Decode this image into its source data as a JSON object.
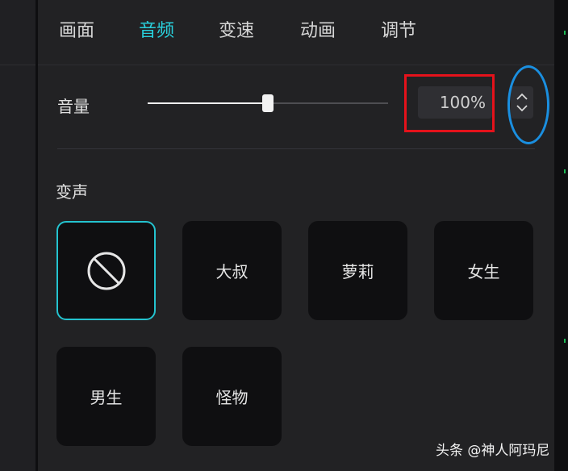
{
  "tabs": [
    "画面",
    "音频",
    "变速",
    "动画",
    "调节"
  ],
  "active_tab": "音频",
  "volume": {
    "label": "音量",
    "value_text": "100%",
    "level_fraction": 0.5
  },
  "voice_change": {
    "label": "变声",
    "presets": [
      {
        "id": "none",
        "label": "",
        "icon": "no-symbol-icon",
        "selected": true
      },
      {
        "id": "dashu",
        "label": "大叔",
        "selected": false
      },
      {
        "id": "luoli",
        "label": "萝莉",
        "selected": false
      },
      {
        "id": "nvsheng",
        "label": "女生",
        "selected": false
      },
      {
        "id": "nansheng",
        "label": "男生",
        "selected": false
      },
      {
        "id": "guaiwu",
        "label": "怪物",
        "selected": false
      }
    ]
  },
  "colors": {
    "accent": "#29d0dc",
    "highlight_red": "#e5121b",
    "highlight_blue": "#1a8fe0"
  },
  "watermark": "头条 @神人阿玛尼"
}
